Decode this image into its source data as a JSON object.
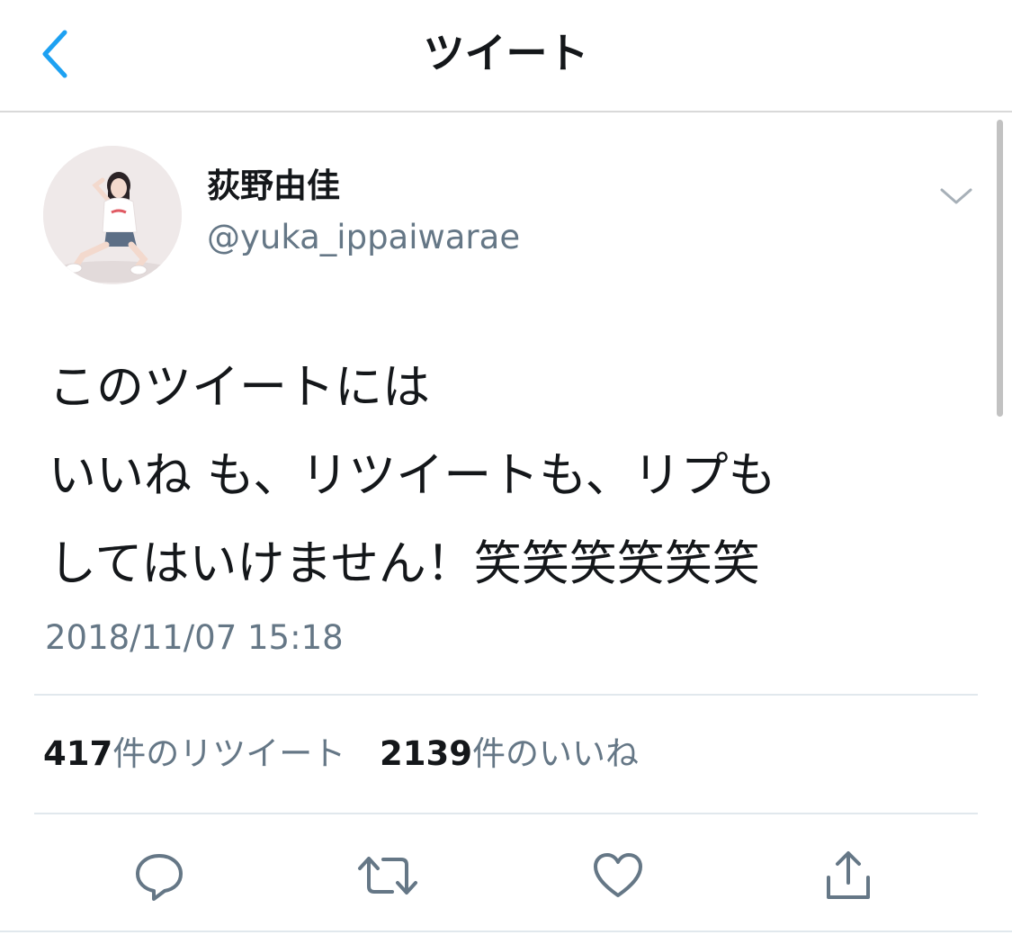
{
  "header": {
    "title": "ツイート",
    "back_icon": "chevron-left-icon"
  },
  "colors": {
    "accent": "#1DA1F2",
    "text_primary": "#14171A",
    "text_secondary": "#657786",
    "divider": "#E1E8ED",
    "icon": "#657786"
  },
  "tweet": {
    "author": {
      "display_name": "荻野由佳",
      "handle": "@yuka_ippaiwarae",
      "avatar_icon": "user-avatar"
    },
    "menu_icon": "chevron-down-icon",
    "text_lines": [
      "このツイートには",
      "いいね も、リツイートも、リプも",
      "してはいけません！笑笑笑笑笑笑"
    ],
    "timestamp": "2018/11/07 15:18"
  },
  "stats": {
    "retweets": {
      "count": "417",
      "label": "件のリツイート"
    },
    "likes": {
      "count": "2139",
      "label": "件のいいね"
    }
  },
  "actions": [
    {
      "name": "reply",
      "icon": "reply-icon"
    },
    {
      "name": "retweet",
      "icon": "retweet-icon"
    },
    {
      "name": "like",
      "icon": "heart-icon"
    },
    {
      "name": "share",
      "icon": "share-icon"
    }
  ]
}
